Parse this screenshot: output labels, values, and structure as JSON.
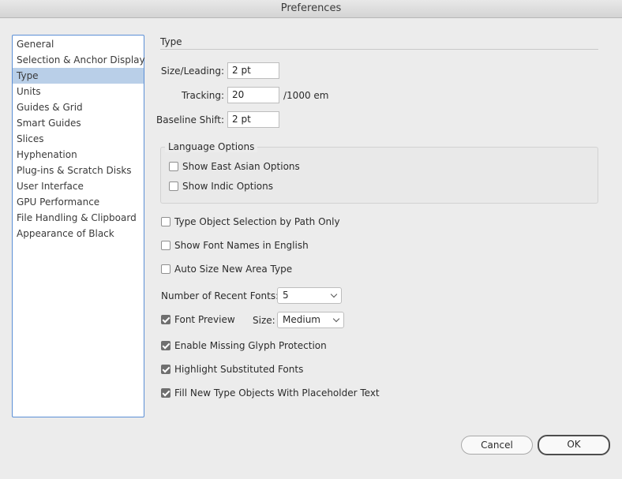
{
  "window": {
    "title": "Preferences"
  },
  "sidebar": {
    "items": [
      {
        "label": "General"
      },
      {
        "label": "Selection & Anchor Display"
      },
      {
        "label": "Type",
        "selected": true
      },
      {
        "label": "Units"
      },
      {
        "label": "Guides & Grid"
      },
      {
        "label": "Smart Guides"
      },
      {
        "label": "Slices"
      },
      {
        "label": "Hyphenation"
      },
      {
        "label": "Plug-ins & Scratch Disks"
      },
      {
        "label": "User Interface"
      },
      {
        "label": "GPU Performance"
      },
      {
        "label": "File Handling & Clipboard"
      },
      {
        "label": "Appearance of Black"
      }
    ]
  },
  "section": {
    "title": "Type"
  },
  "fields": {
    "size_leading": {
      "label": "Size/Leading:",
      "value": "2 pt"
    },
    "tracking": {
      "label": "Tracking:",
      "value": "20",
      "unit": "/1000 em"
    },
    "baseline_shift": {
      "label": "Baseline Shift:",
      "value": "2 pt"
    }
  },
  "language_options": {
    "title": "Language Options",
    "east_asian": {
      "label": "Show East Asian Options",
      "checked": false
    },
    "indic": {
      "label": "Show Indic Options",
      "checked": false
    }
  },
  "options": {
    "path_only": {
      "label": "Type Object Selection by Path Only",
      "checked": false
    },
    "font_names_english": {
      "label": "Show Font Names in English",
      "checked": false
    },
    "auto_size": {
      "label": "Auto Size New Area Type",
      "checked": false
    },
    "recent_fonts": {
      "label": "Number of Recent Fonts:",
      "value": "5"
    },
    "font_preview": {
      "label": "Font Preview",
      "checked": true,
      "size_label": "Size:",
      "size_value": "Medium"
    },
    "missing_glyph": {
      "label": "Enable Missing Glyph Protection",
      "checked": true
    },
    "highlight_substituted": {
      "label": "Highlight Substituted Fonts",
      "checked": true
    },
    "placeholder_text": {
      "label": "Fill New Type Objects With Placeholder Text",
      "checked": true
    }
  },
  "buttons": {
    "cancel": "Cancel",
    "ok": "OK"
  },
  "colors": {
    "selection": "#b9cfe8",
    "focus_border": "#5b8fd6",
    "background": "#ececec"
  }
}
